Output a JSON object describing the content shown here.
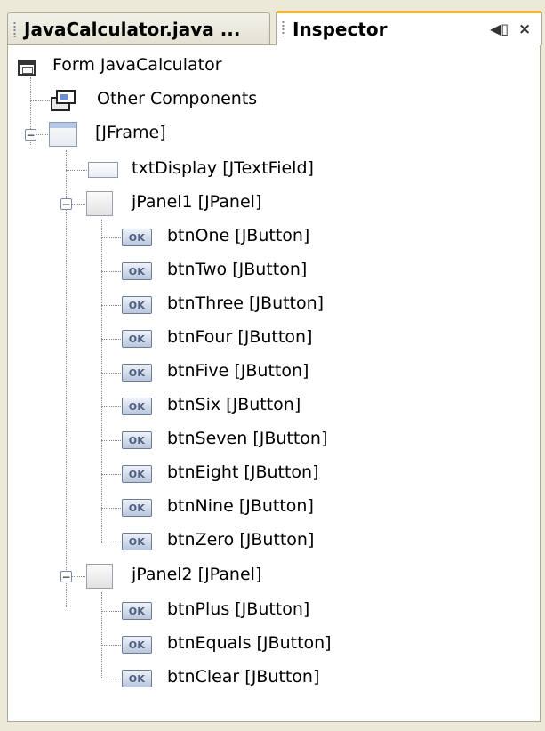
{
  "tabs": [
    {
      "label": "JavaCalculator.java ...",
      "active": false
    },
    {
      "label": "Inspector",
      "active": true
    }
  ],
  "tab_controls": {
    "minimize": "◀▯",
    "close": "×"
  },
  "tree": {
    "root": "Form JavaCalculator",
    "other": "Other Components",
    "frame": "[JFrame]",
    "txt": "txtDisplay [JTextField]",
    "panel1": "jPanel1 [JPanel]",
    "panel1_items": [
      "btnOne [JButton]",
      "btnTwo [JButton]",
      "btnThree [JButton]",
      "btnFour [JButton]",
      "btnFive [JButton]",
      "btnSix [JButton]",
      "btnSeven [JButton]",
      "btnEight [JButton]",
      "btnNine [JButton]",
      "btnZero [JButton]"
    ],
    "panel2": "jPanel2 [JPanel]",
    "panel2_items": [
      "btnPlus [JButton]",
      "btnEquals [JButton]",
      "btnClear [JButton]"
    ],
    "toggle_symbol": "−",
    "button_icon_text": "OK"
  },
  "colors": {
    "active_tab_accent": "#f5b227",
    "background": "#ece9d8"
  }
}
